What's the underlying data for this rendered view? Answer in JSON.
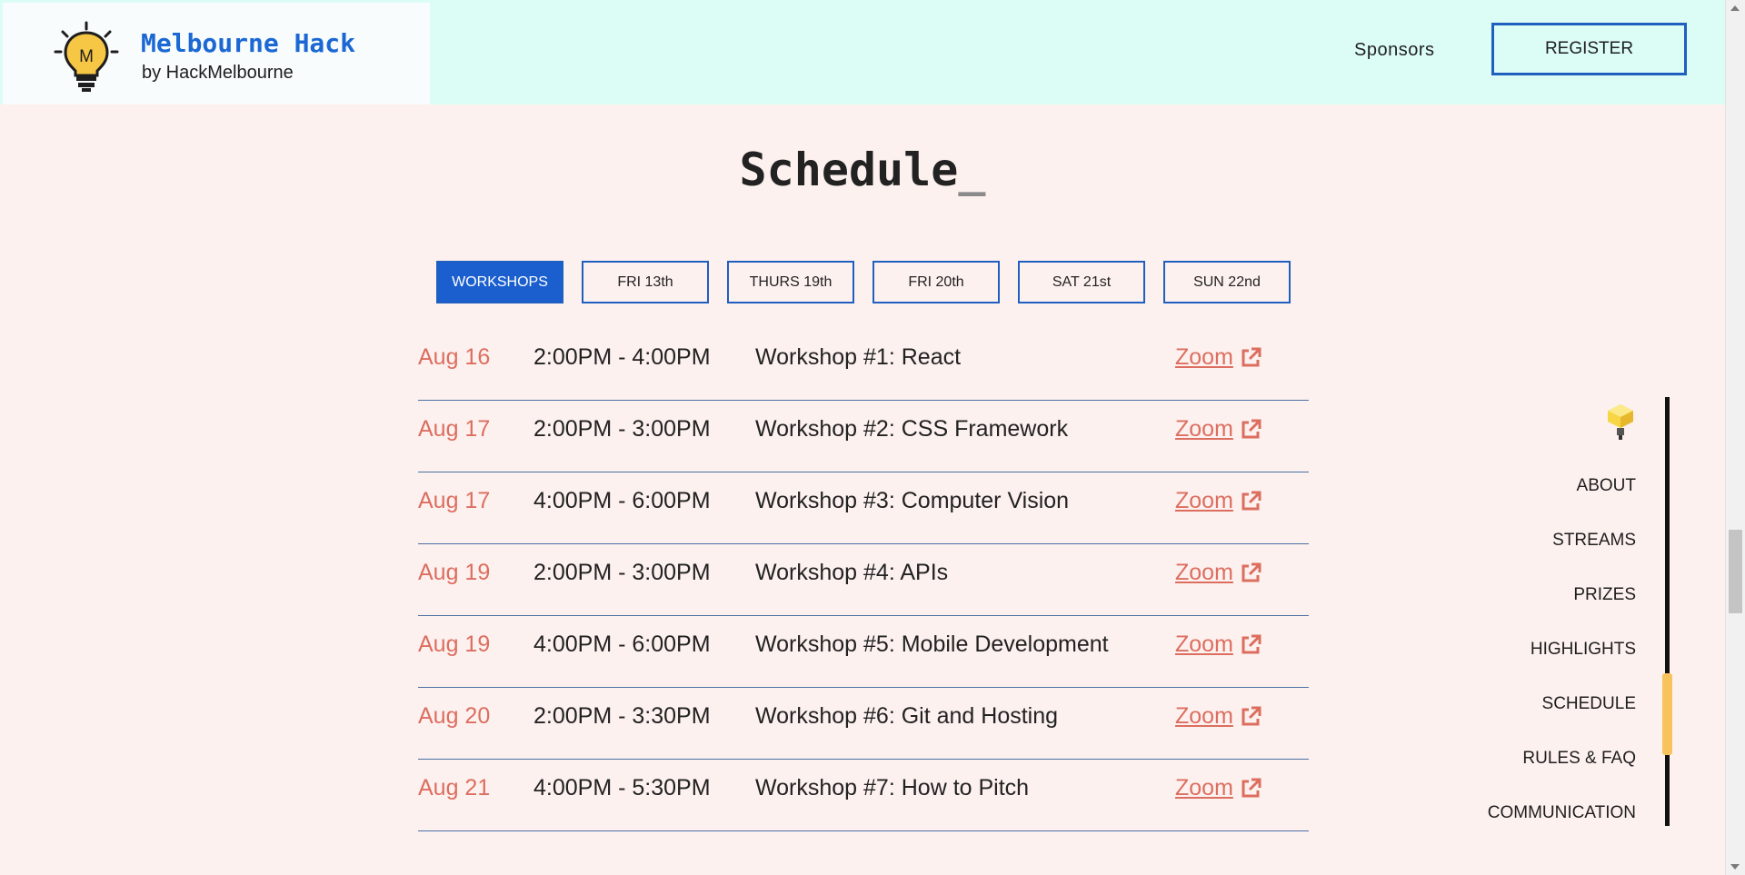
{
  "header": {
    "logo_letter": "M",
    "brand_title": "Melbourne Hack",
    "brand_subtitle": "by HackMelbourne",
    "nav_sponsors": "Sponsors",
    "register_label": "REGISTER"
  },
  "section": {
    "title": "Schedule",
    "cursor": "_"
  },
  "tabs": [
    {
      "label": "WORKSHOPS",
      "active": true
    },
    {
      "label": "FRI 13th",
      "active": false
    },
    {
      "label": "THURS 19th",
      "active": false
    },
    {
      "label": "FRI 20th",
      "active": false
    },
    {
      "label": "SAT 21st",
      "active": false
    },
    {
      "label": "SUN 22nd",
      "active": false
    }
  ],
  "schedule": [
    {
      "date": "Aug 16",
      "time": "2:00PM - 4:00PM",
      "title": "Workshop #1: React",
      "link": "Zoom"
    },
    {
      "date": "Aug 17",
      "time": "2:00PM - 3:00PM",
      "title": "Workshop #2: CSS Framework",
      "link": "Zoom"
    },
    {
      "date": "Aug 17",
      "time": "4:00PM - 6:00PM",
      "title": "Workshop #3: Computer Vision",
      "link": "Zoom"
    },
    {
      "date": "Aug 19",
      "time": "2:00PM - 3:00PM",
      "title": "Workshop #4: APIs",
      "link": "Zoom"
    },
    {
      "date": "Aug 19",
      "time": "4:00PM - 6:00PM",
      "title": "Workshop #5: Mobile Development",
      "link": "Zoom"
    },
    {
      "date": "Aug 20",
      "time": "2:00PM - 3:30PM",
      "title": "Workshop #6: Git and Hosting",
      "link": "Zoom"
    },
    {
      "date": "Aug 21",
      "time": "4:00PM - 5:30PM",
      "title": "Workshop #7: How to Pitch",
      "link": "Zoom"
    }
  ],
  "sidenav": {
    "items": [
      "ABOUT",
      "STREAMS",
      "PRIZES",
      "HIGHLIGHTS",
      "SCHEDULE",
      "RULES & FAQ",
      "COMMUNICATION"
    ],
    "active": "SCHEDULE"
  },
  "colors": {
    "brand_blue": "#1b68d4",
    "accent_red": "#dc6e5f",
    "active_marker": "#f8c25c",
    "header_bg": "#dcfdf6",
    "page_bg": "#fdf1ef"
  },
  "icons": {
    "logo": "lightbulb-logo-icon",
    "link": "external-link-icon",
    "sidenav_top": "lightbulb-icon"
  }
}
